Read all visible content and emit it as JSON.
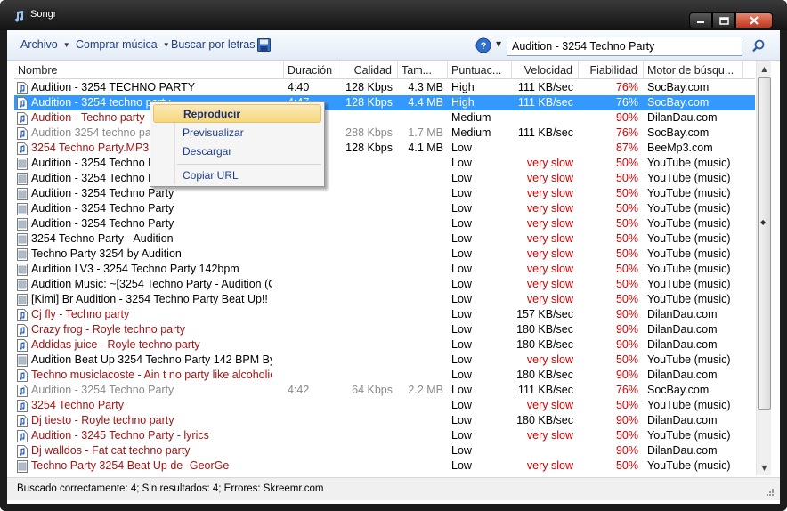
{
  "window": {
    "title": "Songr"
  },
  "toolbar": {
    "archivo": "Archivo",
    "comprar": "Comprar música",
    "buscar_letras": "Buscar por letras",
    "search_value": "Audition - 3254 Techno Party"
  },
  "columns": {
    "name": "Nombre",
    "duration": "Duración",
    "quality": "Calidad",
    "size": "Tam...",
    "rating": "Puntuac...",
    "speed": "Velocidad",
    "reliability": "Fiabilidad",
    "engine": "Motor de búsqu..."
  },
  "rows": [
    {
      "name": "Audition - 3254 TECHNO PARTY",
      "duration": "4:40",
      "quality": "128 Kbps",
      "size": "4.3 MB",
      "rating": "High",
      "speed": "111 KB/sec",
      "reliability": "76%",
      "engine": "SocBay.com",
      "style": "normal",
      "icon": "audio-file"
    },
    {
      "name": "Audition - 3254 techno party",
      "duration": "4:47",
      "quality": "128 Kbps",
      "size": "4.4 MB",
      "rating": "High",
      "speed": "111 KB/sec",
      "reliability": "76%",
      "engine": "SocBay.com",
      "style": "selected",
      "icon": "audio-file"
    },
    {
      "name": "Audition - Techno party",
      "duration": "",
      "quality": "",
      "size": "",
      "rating": "Medium",
      "speed": "",
      "reliability": "90%",
      "engine": "DilanDau.com",
      "style": "maroon",
      "icon": "audio-file"
    },
    {
      "name": "Audition 3254 techno party",
      "duration": "",
      "quality": "288 Kbps",
      "size": "1.7 MB",
      "rating": "Medium",
      "speed": "111 KB/sec",
      "reliability": "76%",
      "engine": "SocBay.com",
      "style": "grey",
      "icon": "audio-file"
    },
    {
      "name": "3254 Techno Party.MP3",
      "duration": "",
      "quality": "128 Kbps",
      "size": "4.1 MB",
      "rating": "Low",
      "speed": "",
      "reliability": "87%",
      "engine": "BeeMp3.com",
      "style": "maroon",
      "icon": "audio-file"
    },
    {
      "name": "Audition - 3254 Techno Party",
      "duration": "",
      "quality": "",
      "size": "",
      "rating": "Low",
      "speed": "very slow",
      "reliability": "50%",
      "engine": "YouTube (music)",
      "style": "normal",
      "icon": "video-file"
    },
    {
      "name": "Audition - 3254 Techno Party",
      "duration": "",
      "quality": "",
      "size": "",
      "rating": "Low",
      "speed": "very slow",
      "reliability": "50%",
      "engine": "YouTube (music)",
      "style": "normal",
      "icon": "video-file"
    },
    {
      "name": "Audition - 3254 Techno Party",
      "duration": "",
      "quality": "",
      "size": "",
      "rating": "Low",
      "speed": "very slow",
      "reliability": "50%",
      "engine": "YouTube (music)",
      "style": "normal",
      "icon": "video-file"
    },
    {
      "name": "Audition - 3254 Techno Party",
      "duration": "",
      "quality": "",
      "size": "",
      "rating": "Low",
      "speed": "very slow",
      "reliability": "50%",
      "engine": "YouTube (music)",
      "style": "normal",
      "icon": "video-file"
    },
    {
      "name": "Audition - 3254 Techno Party",
      "duration": "",
      "quality": "",
      "size": "",
      "rating": "Low",
      "speed": "very slow",
      "reliability": "50%",
      "engine": "YouTube (music)",
      "style": "normal",
      "icon": "video-file"
    },
    {
      "name": "3254 Techno Party - Audition",
      "duration": "",
      "quality": "",
      "size": "",
      "rating": "Low",
      "speed": "very slow",
      "reliability": "50%",
      "engine": "YouTube (music)",
      "style": "normal",
      "icon": "video-file"
    },
    {
      "name": "Techno Party 3254 by Audition",
      "duration": "",
      "quality": "",
      "size": "",
      "rating": "Low",
      "speed": "very slow",
      "reliability": "50%",
      "engine": "YouTube (music)",
      "style": "normal",
      "icon": "video-file"
    },
    {
      "name": "Audition LV3 - 3254 Techno Party 142bpm",
      "duration": "",
      "quality": "",
      "size": "",
      "rating": "Low",
      "speed": "very slow",
      "reliability": "50%",
      "engine": "YouTube (music)",
      "style": "normal",
      "icon": "video-file"
    },
    {
      "name": "Audition Music: ~[3254 Techno Party - Audition (O...",
      "duration": "",
      "quality": "",
      "size": "",
      "rating": "Low",
      "speed": "very slow",
      "reliability": "50%",
      "engine": "YouTube (music)",
      "style": "normal",
      "icon": "video-file"
    },
    {
      "name": "[Kimi] Br Audition - 3254 Techno Party Beat Up!!",
      "duration": "",
      "quality": "",
      "size": "",
      "rating": "Low",
      "speed": "very slow",
      "reliability": "50%",
      "engine": "YouTube (music)",
      "style": "normal",
      "icon": "video-file"
    },
    {
      "name": "Cj fly - Techno party",
      "duration": "",
      "quality": "",
      "size": "",
      "rating": "Low",
      "speed": "157 KB/sec",
      "reliability": "90%",
      "engine": "DilanDau.com",
      "style": "maroon",
      "icon": "audio-file"
    },
    {
      "name": "Crazy frog - Royle techno party",
      "duration": "",
      "quality": "",
      "size": "",
      "rating": "Low",
      "speed": "180 KB/sec",
      "reliability": "90%",
      "engine": "DilanDau.com",
      "style": "maroon",
      "icon": "audio-file"
    },
    {
      "name": "Addidas juice - Royle techno party",
      "duration": "",
      "quality": "",
      "size": "",
      "rating": "Low",
      "speed": "180 KB/sec",
      "reliability": "90%",
      "engine": "DilanDau.com",
      "style": "maroon",
      "icon": "audio-file"
    },
    {
      "name": "Audition Beat Up 3254 Techno Party 142 BPM By Bl...",
      "duration": "",
      "quality": "",
      "size": "",
      "rating": "Low",
      "speed": "very slow",
      "reliability": "50%",
      "engine": "YouTube (music)",
      "style": "normal",
      "icon": "video-file"
    },
    {
      "name": "Techno musiclacoste - Ain t no party like alcoholic ...",
      "duration": "",
      "quality": "",
      "size": "",
      "rating": "Low",
      "speed": "180 KB/sec",
      "reliability": "90%",
      "engine": "DilanDau.com",
      "style": "maroon",
      "icon": "audio-file"
    },
    {
      "name": "Audition - 3254 Techno Party",
      "duration": "4:42",
      "quality": "64 Kbps",
      "size": "2.2 MB",
      "rating": "Low",
      "speed": "111 KB/sec",
      "reliability": "76%",
      "engine": "SocBay.com",
      "style": "grey",
      "icon": "audio-file"
    },
    {
      "name": "3254 Techno Party",
      "duration": "",
      "quality": "",
      "size": "",
      "rating": "Low",
      "speed": "very slow",
      "reliability": "50%",
      "engine": "YouTube (music)",
      "style": "maroon",
      "icon": "audio-file"
    },
    {
      "name": "Dj tiesto - Royle techno party",
      "duration": "",
      "quality": "",
      "size": "",
      "rating": "Low",
      "speed": "180 KB/sec",
      "reliability": "90%",
      "engine": "DilanDau.com",
      "style": "maroon",
      "icon": "audio-file"
    },
    {
      "name": "Audition - 3245 Techno Party - lyrics",
      "duration": "",
      "quality": "",
      "size": "",
      "rating": "Low",
      "speed": "very slow",
      "reliability": "50%",
      "engine": "YouTube (music)",
      "style": "maroon",
      "icon": "audio-file"
    },
    {
      "name": "Dj walldos - Fat cat techno party",
      "duration": "",
      "quality": "",
      "size": "",
      "rating": "Low",
      "speed": "",
      "reliability": "90%",
      "engine": "DilanDau.com",
      "style": "maroon",
      "icon": "audio-file"
    },
    {
      "name": "Techno Party 3254 Beat Up de -GeorGe",
      "duration": "",
      "quality": "",
      "size": "",
      "rating": "Low",
      "speed": "very slow",
      "reliability": "50%",
      "engine": "YouTube (music)",
      "style": "maroon",
      "icon": "video-file"
    }
  ],
  "context_menu": {
    "play": "Reproducir",
    "preview": "Previsualizar",
    "download": "Descargar",
    "copy_url": "Copiar URL"
  },
  "status": {
    "text": "Buscado correctamente: 4; Sin resultados: 4; Errores: Skreemr.com"
  },
  "colors": {
    "selection": "#3399ff",
    "very_slow": "#d40000",
    "maroon_title": "#a31515",
    "link": "#1e3e8a"
  }
}
